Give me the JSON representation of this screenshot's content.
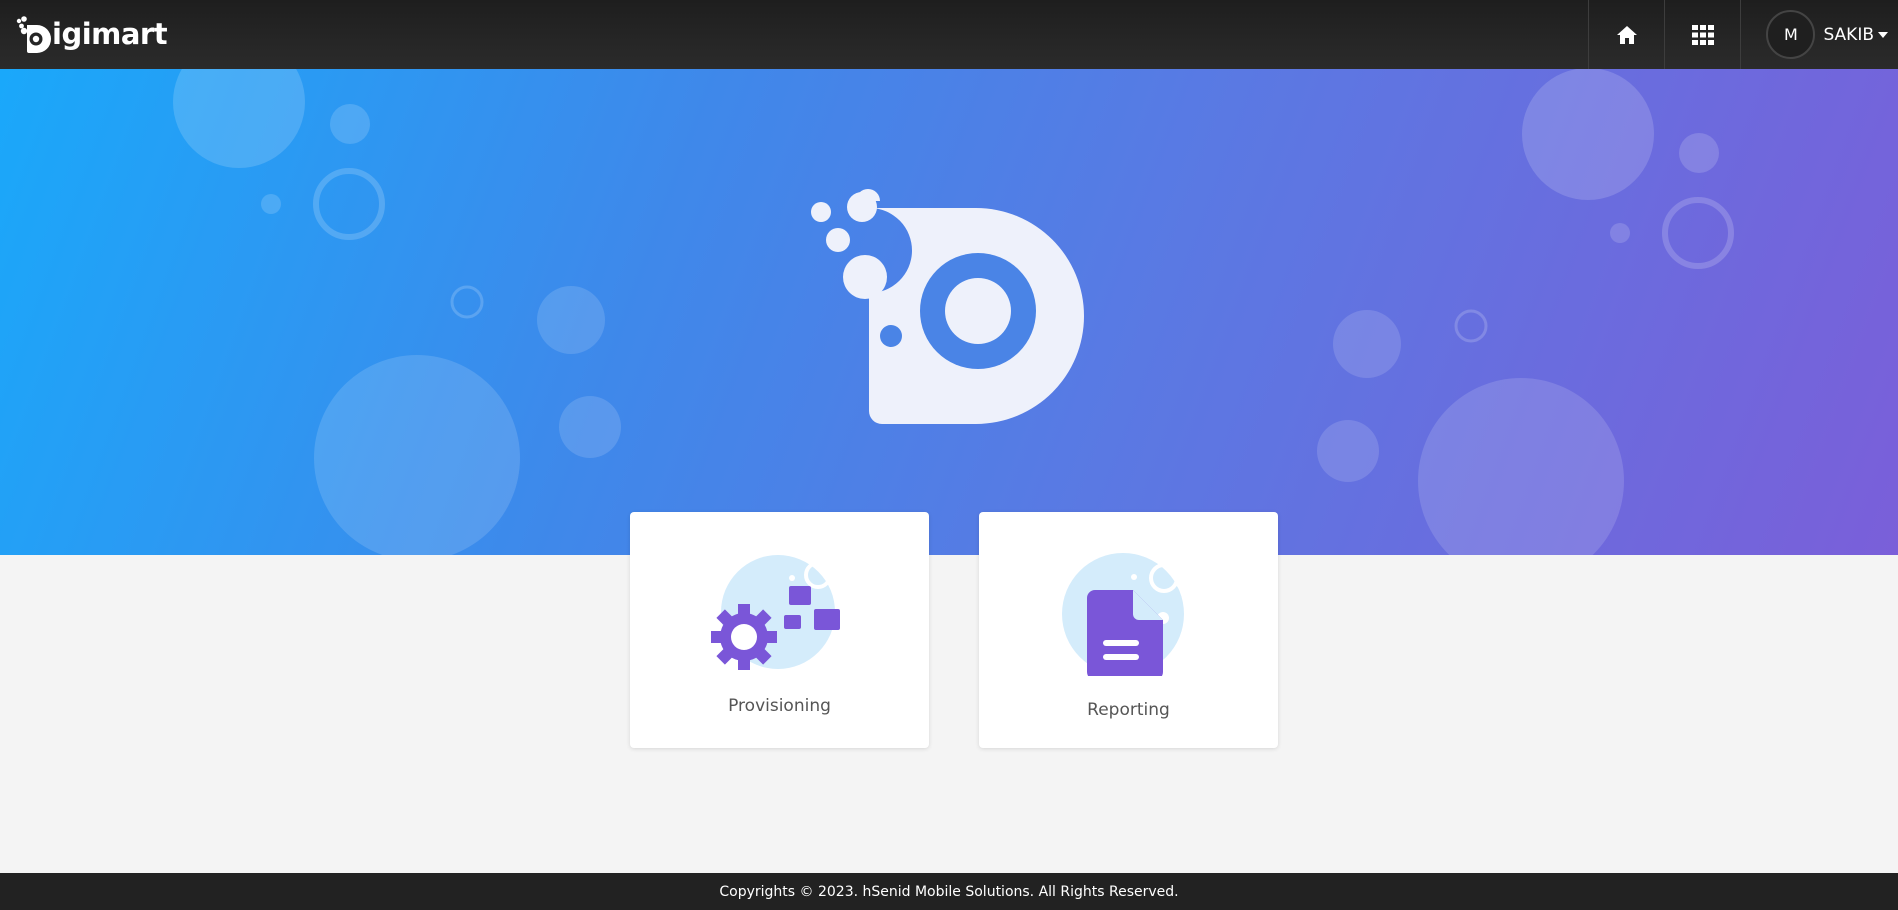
{
  "header": {
    "brand": "igimart",
    "home_icon": "home-icon",
    "apps_icon": "apps-grid-icon",
    "user": {
      "avatar_initial": "M",
      "name": "SAKIB"
    }
  },
  "hero": {
    "logo_icon": "digimart-logo-icon"
  },
  "cards": [
    {
      "label": "Provisioning",
      "icon": "provisioning-gear-icon"
    },
    {
      "label": "Reporting",
      "icon": "reporting-document-icon"
    }
  ],
  "footer": {
    "copyright": "Copyrights © 2023. hSenid Mobile Solutions. All Rights Reserved."
  },
  "colors": {
    "topbar": "#222222",
    "hero_gradient_start": "#1aa8fa",
    "hero_gradient_end": "#7a5fd9",
    "card_accent": "#7a56d8",
    "card_icon_bg": "#d4ecfb"
  }
}
